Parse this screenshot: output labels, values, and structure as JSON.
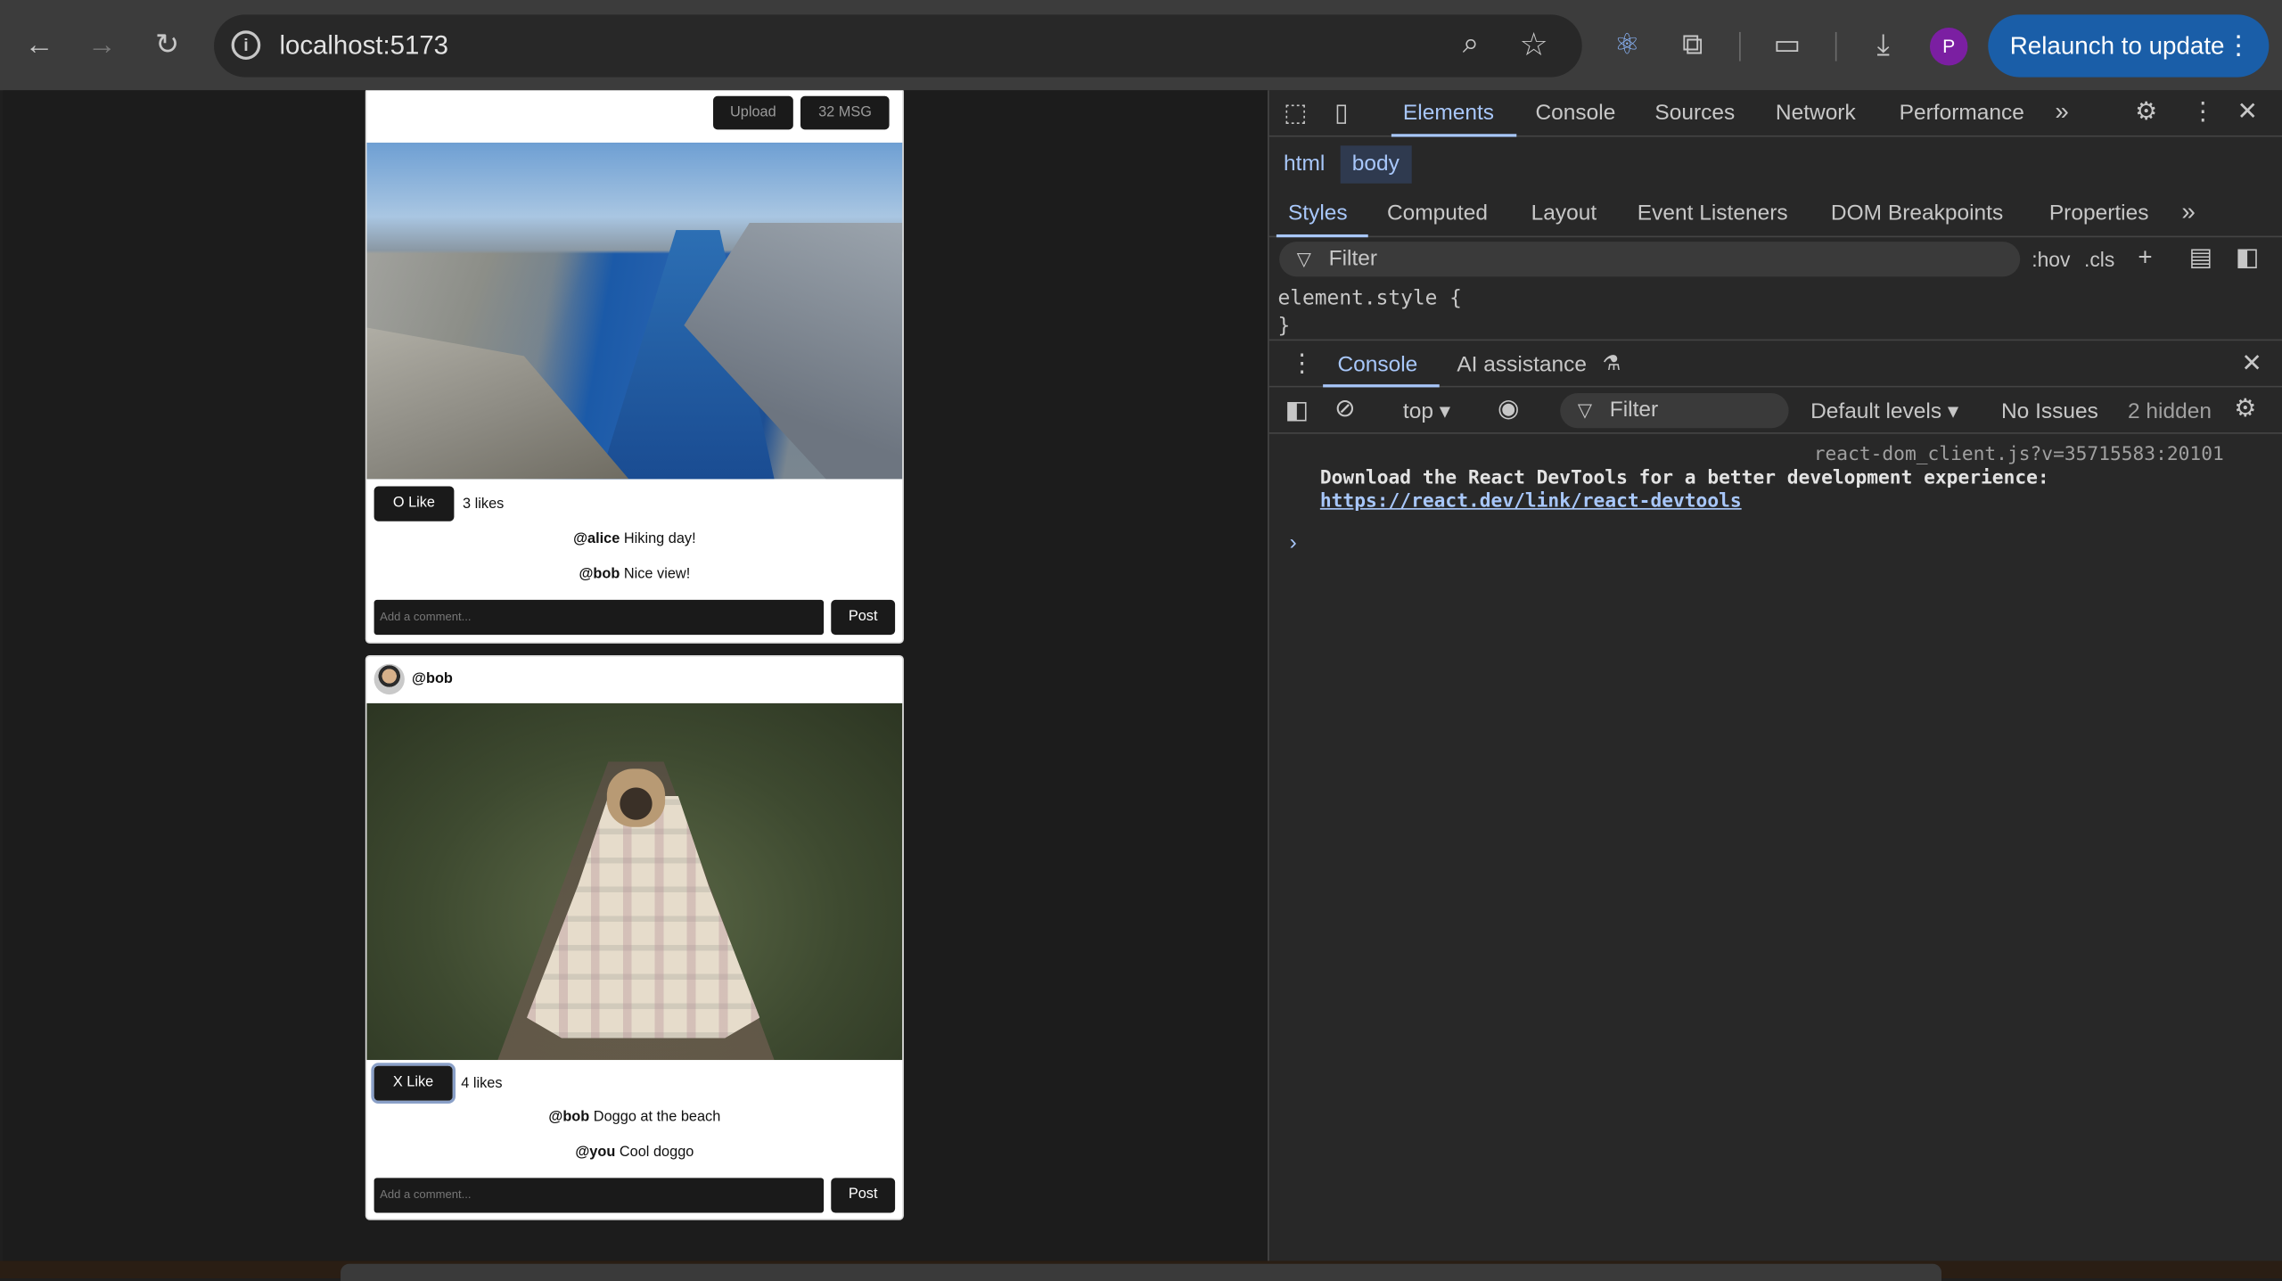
{
  "browser": {
    "url": "localhost:5173",
    "relaunch_label": "Relaunch to update",
    "profile_initial": "P"
  },
  "feed": {
    "top_buttons": [
      "Upload",
      "32 MSG"
    ],
    "posts": [
      {
        "author": "",
        "image": "fjord-landscape",
        "like_label": "O Like",
        "likes_text": "3 likes",
        "comments": [
          {
            "user": "@alice",
            "text": "Hiking day!"
          },
          {
            "user": "@bob",
            "text": "Nice view!"
          }
        ],
        "comment_placeholder": "Add a comment...",
        "post_label": "Post"
      },
      {
        "author": "@bob",
        "image": "pug-in-blanket",
        "like_label": "X Like",
        "likes_text": "4 likes",
        "comments": [
          {
            "user": "@bob",
            "text": "Doggo at the beach"
          },
          {
            "user": "@you",
            "text": "Cool doggo"
          }
        ],
        "comment_placeholder": "Add a comment...",
        "post_label": "Post"
      }
    ]
  },
  "devtools": {
    "tabs": [
      "Elements",
      "Console",
      "Sources",
      "Network",
      "Performance"
    ],
    "active_tab": "Elements",
    "breadcrumbs": [
      "html",
      "body"
    ],
    "style_tabs": [
      "Styles",
      "Computed",
      "Layout",
      "Event Listeners",
      "DOM Breakpoints",
      "Properties"
    ],
    "filter_placeholder": "Filter",
    "hov": ":hov",
    "cls": ".cls",
    "element_style_open": "element.style {",
    "element_style_close": "}",
    "drawer_tabs": [
      "Console",
      "AI assistance"
    ],
    "context": "top",
    "console_filter": "Filter",
    "levels": "Default levels",
    "issues": "No Issues",
    "hidden": "2 hidden",
    "message_source": "react-dom_client.js?v=35715583:20101",
    "message_line1": "Download the React DevTools for a better development experience:",
    "message_link": "https://react.dev/link/react-devtools",
    "prompt": "›"
  }
}
